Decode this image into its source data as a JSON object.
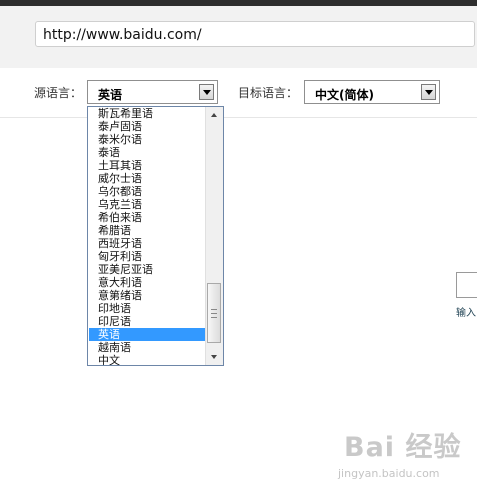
{
  "address_bar": {
    "url": "http://www.baidu.com/"
  },
  "translation_bar": {
    "source_label": "源语言：",
    "source_value": "英语",
    "target_label": "目标语言：",
    "target_value": "中文(简体)"
  },
  "source_dropdown": {
    "options": [
      "斯瓦希里语",
      "泰卢固语",
      "泰米尔语",
      "泰语",
      "土耳其语",
      "威尔士语",
      "乌尔都语",
      "乌克兰语",
      "希伯来语",
      "希腊语",
      "西班牙语",
      "匈牙利语",
      "亚美尼亚语",
      "意大利语",
      "意第绪语",
      "印地语",
      "印尼语",
      "英语",
      "越南语",
      "中文"
    ],
    "selected_index": 17,
    "scroll_position": 0.92
  },
  "right_panel": {
    "input_label": "输入"
  },
  "watermark": {
    "text_cn": "Bai 经验",
    "text_en": "jingyan.baidu.com"
  },
  "colors": {
    "selection": "#3399ff",
    "dropdown_border": "#6d86a8"
  }
}
